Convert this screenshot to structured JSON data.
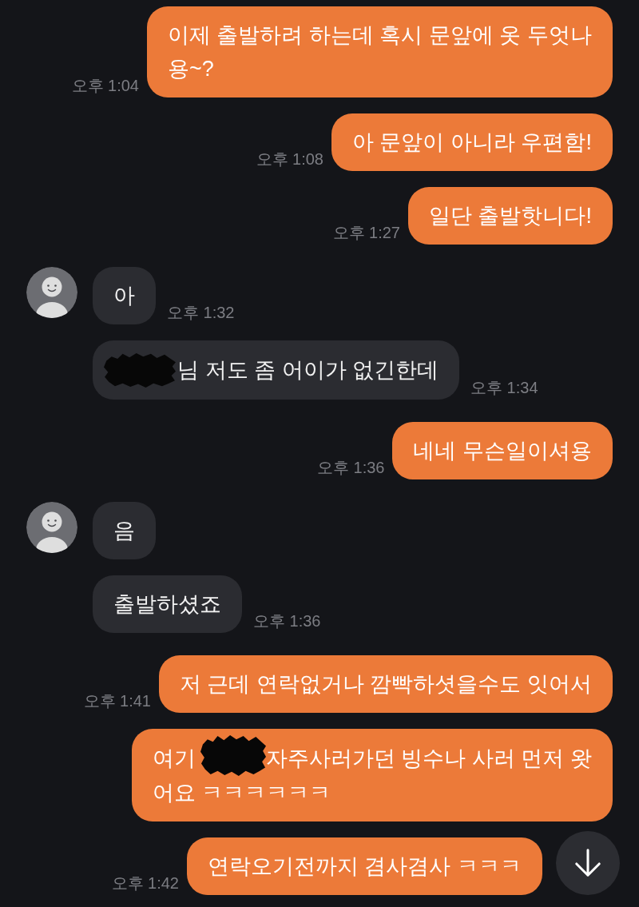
{
  "conversation": [
    {
      "kind": "outgoing",
      "messages": [
        {
          "lines": [
            [
              {
                "kind": "text",
                "text": "이제 출발하려 하는데 혹시 문앞에 옷 두엇나"
              }
            ],
            [
              {
                "kind": "text",
                "text": "용~?"
              }
            ]
          ],
          "time": "오후 1:04"
        },
        {
          "lines": [
            [
              {
                "kind": "text",
                "text": "아 문앞이 아니라 우편함!"
              }
            ]
          ],
          "time": "오후 1:08"
        },
        {
          "lines": [
            [
              {
                "kind": "text",
                "text": "일단 출발핫니다!"
              }
            ]
          ],
          "time": "오후 1:27"
        }
      ]
    },
    {
      "kind": "incoming",
      "messages": [
        {
          "lines": [
            [
              {
                "kind": "text",
                "text": "아"
              }
            ]
          ],
          "time": "오후 1:32"
        },
        {
          "lines": [
            [
              {
                "kind": "redaction"
              },
              {
                "kind": "text",
                "text": "님 저도 좀 어이가 없긴한데"
              }
            ]
          ],
          "time": "오후 1:34"
        }
      ]
    },
    {
      "kind": "outgoing",
      "messages": [
        {
          "lines": [
            [
              {
                "kind": "text",
                "text": "네네 무슨일이셔용"
              }
            ]
          ],
          "time": "오후 1:36"
        }
      ]
    },
    {
      "kind": "incoming",
      "messages": [
        {
          "lines": [
            [
              {
                "kind": "text",
                "text": "음"
              }
            ]
          ]
        },
        {
          "lines": [
            [
              {
                "kind": "text",
                "text": "출발하셨죠"
              }
            ]
          ],
          "time": "오후 1:36"
        }
      ]
    },
    {
      "kind": "outgoing",
      "messages": [
        {
          "lines": [
            [
              {
                "kind": "text",
                "text": "저 근데 연락없거나 깜빡하셧을수도 잇어서"
              }
            ]
          ],
          "time": "오후 1:41"
        },
        {
          "lines": [
            [
              {
                "kind": "text",
                "text": "여기"
              },
              {
                "kind": "redaction"
              },
              {
                "kind": "text",
                "text": "자주사러가던 빙수나 사러 먼저 왓"
              }
            ],
            [
              {
                "kind": "text",
                "text": "어요 ㅋㅋㅋㅋㅋㅋ"
              }
            ]
          ]
        },
        {
          "lines": [
            [
              {
                "kind": "text",
                "text": "연락오기전까지 겸사겸사 ㅋㅋㅋ"
              }
            ]
          ],
          "time": "오후 1:42"
        }
      ]
    }
  ]
}
